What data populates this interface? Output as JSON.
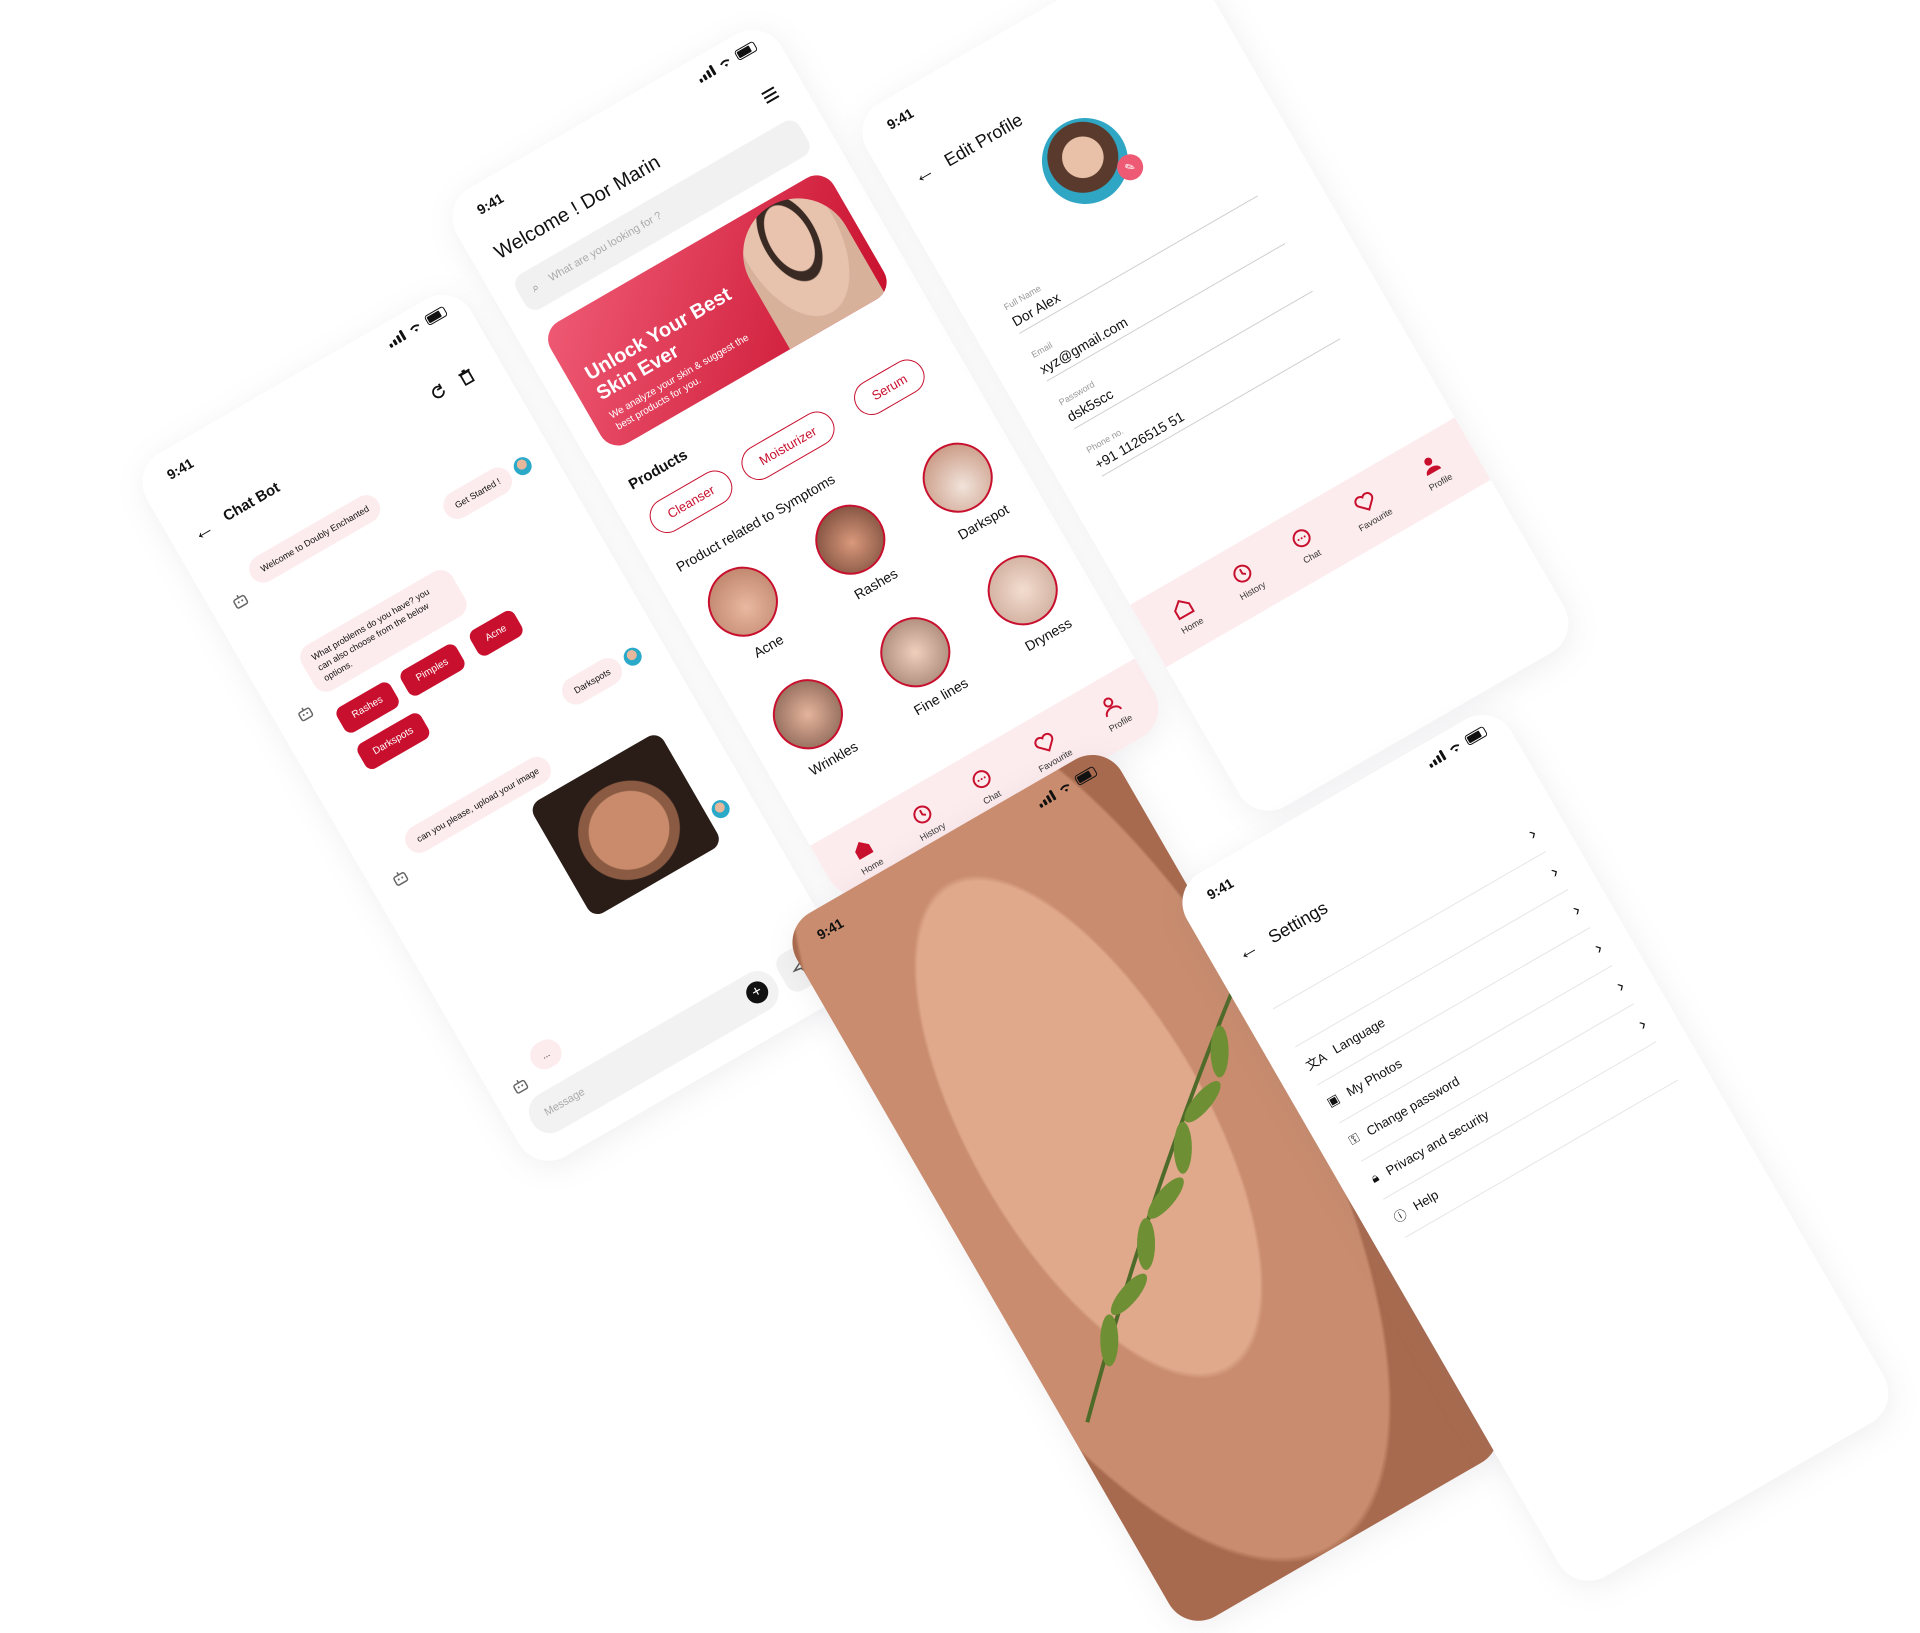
{
  "status": {
    "time": "9:41"
  },
  "chatbot": {
    "title": "Chat Bot",
    "messages": {
      "welcome": "Welcome to Doubly Enchanted",
      "get_started": "Get Started !",
      "problems": "What problems do you have? you can also choose from the below options.",
      "darkspots_reply": "Darkspots",
      "upload": "can you please, upload your image",
      "typing": "..."
    },
    "options": [
      "Rashes",
      "Pimples",
      "Acne",
      "Darkspots"
    ],
    "input_placeholder": "Message"
  },
  "home": {
    "welcome": "Welcome ! Dor Marin",
    "search_placeholder": "What are you looking for ?",
    "banner": {
      "title": "Unlock Your Best Skin Ever",
      "subtitle": "We analyze your skin & suggest the best products for you."
    },
    "products_title": "Products",
    "products": [
      "Cleanser",
      "Moisturizer",
      "Serum"
    ],
    "symptoms_title": "Product related to Symptoms",
    "symptoms": [
      "Acne",
      "Rashes",
      "Darkspot",
      "Wrinkles",
      "Fine lines",
      "Dryness"
    ]
  },
  "nav": {
    "items": [
      "Home",
      "History",
      "Chat",
      "Favourite",
      "Profile"
    ]
  },
  "edit_profile": {
    "title": "Edit Profile",
    "fields": [
      {
        "label": "Full Name",
        "value": "Dor Alex"
      },
      {
        "label": "Email",
        "value": "xyz@gmail.com"
      },
      {
        "label": "Password",
        "value": "dsk5scc"
      },
      {
        "label": "Phone no.",
        "value": "+91 1126515 51"
      }
    ]
  },
  "settings": {
    "title": "Settings",
    "items": [
      "Language",
      "My Photos",
      "Change password",
      "Privacy and security",
      "Help"
    ]
  },
  "colors": {
    "accent": "#c8102e",
    "soft": "#fdecee"
  }
}
